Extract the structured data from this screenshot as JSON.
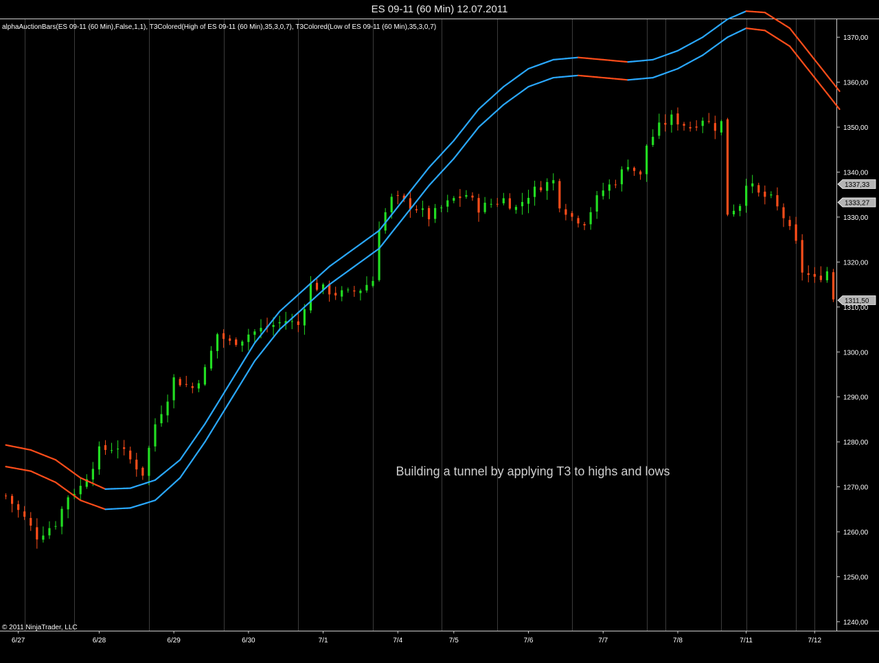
{
  "window": {
    "title": "ES 09-11 (60 Min)  12.07.2011"
  },
  "indicator_label": "alphaAuctionBars(ES 09-11 (60 Min),False,1,1), T3Colored(High of ES 09-11 (60 Min),35,3,0,7), T3Colored(Low of ES 09-11 (60 Min),35,3,0,7)",
  "annotation": "Building a tunnel by applying T3 to highs and lows",
  "copyright": "© 2011 NinjaTrader, LLC",
  "colors": {
    "up": "#22dd22",
    "down": "#ff4d1a",
    "t3_rising": "#2aa8ff",
    "t3_falling": "#ff4d1a",
    "grid": "#666666",
    "background": "#000000"
  },
  "chart_data": {
    "type": "line",
    "ylim": [
      1238,
      1374
    ],
    "y_ticks": [
      "1370,00",
      "1360,00",
      "1350,00",
      "1340,00",
      "1330,00",
      "1320,00",
      "1310,00",
      "1300,00",
      "1290,00",
      "1280,00",
      "1270,00",
      "1260,00",
      "1250,00",
      "1240,00"
    ],
    "y_tick_values": [
      1370,
      1360,
      1350,
      1340,
      1330,
      1320,
      1310,
      1300,
      1290,
      1280,
      1270,
      1260,
      1250,
      1240
    ],
    "x_tick_labels": [
      "6/27",
      "6/28",
      "6/29",
      "6/30",
      "7/1",
      "7/4",
      "7/5",
      "7/6",
      "7/7",
      "7/8",
      "7/11",
      "7/12"
    ],
    "x_tick_bar_index": [
      2,
      15,
      27,
      39,
      51,
      63,
      72,
      84,
      96,
      108,
      119,
      130
    ],
    "session_lines_bar_index": [
      3,
      11,
      23,
      35,
      47,
      59,
      70,
      79,
      91,
      103,
      106,
      115,
      119,
      127,
      130
    ],
    "bar_count": 134,
    "price_markers": [
      {
        "label": "1337,33",
        "value": 1337.33
      },
      {
        "label": "1333,27",
        "value": 1333.27
      },
      {
        "label": "1311,50",
        "value": 1311.5
      }
    ],
    "close_anchors": [
      [
        0,
        1268
      ],
      [
        3,
        1263
      ],
      [
        5,
        1259
      ],
      [
        8,
        1262
      ],
      [
        10,
        1268
      ],
      [
        12,
        1270
      ],
      [
        14,
        1275
      ],
      [
        15,
        1278
      ],
      [
        18,
        1279
      ],
      [
        20,
        1276
      ],
      [
        22,
        1273
      ],
      [
        24,
        1284
      ],
      [
        26,
        1290
      ],
      [
        27,
        1294
      ],
      [
        30,
        1292
      ],
      [
        32,
        1296
      ],
      [
        34,
        1304
      ],
      [
        36,
        1302
      ],
      [
        38,
        1303
      ],
      [
        39,
        1304
      ],
      [
        41,
        1305
      ],
      [
        43,
        1306
      ],
      [
        45,
        1307
      ],
      [
        47,
        1306
      ],
      [
        49,
        1315
      ],
      [
        51,
        1314
      ],
      [
        53,
        1313
      ],
      [
        55,
        1313
      ],
      [
        57,
        1314
      ],
      [
        59,
        1316
      ],
      [
        60,
        1328
      ],
      [
        62,
        1334
      ],
      [
        63,
        1334
      ],
      [
        66,
        1332
      ],
      [
        68,
        1330
      ],
      [
        70,
        1332
      ],
      [
        72,
        1334
      ],
      [
        74,
        1335
      ],
      [
        76,
        1332
      ],
      [
        78,
        1333
      ],
      [
        80,
        1334
      ],
      [
        82,
        1332
      ],
      [
        84,
        1335
      ],
      [
        86,
        1337
      ],
      [
        88,
        1338
      ],
      [
        89,
        1333
      ],
      [
        91,
        1330
      ],
      [
        93,
        1329
      ],
      [
        95,
        1334
      ],
      [
        96,
        1336
      ],
      [
        98,
        1338
      ],
      [
        100,
        1342
      ],
      [
        102,
        1339
      ],
      [
        103,
        1346
      ],
      [
        105,
        1350
      ],
      [
        107,
        1352
      ],
      [
        110,
        1350
      ],
      [
        112,
        1352
      ],
      [
        114,
        1350
      ],
      [
        115,
        1351
      ],
      [
        116,
        1331
      ],
      [
        118,
        1333
      ],
      [
        119,
        1338
      ],
      [
        121,
        1335
      ],
      [
        123,
        1334
      ],
      [
        125,
        1330
      ],
      [
        127,
        1324
      ],
      [
        128,
        1318
      ],
      [
        130,
        1316
      ],
      [
        132,
        1318
      ],
      [
        133,
        1312
      ]
    ],
    "series": [
      {
        "values": [
          [
            0,
            1279.3
          ],
          [
            4,
            1278.2
          ],
          [
            8,
            1276
          ],
          [
            12,
            1272
          ],
          [
            16,
            1269.5
          ],
          [
            20,
            1269.7
          ],
          [
            24,
            1271.5
          ],
          [
            28,
            1276
          ],
          [
            32,
            1284
          ],
          [
            36,
            1293
          ],
          [
            40,
            1302
          ],
          [
            44,
            1309
          ],
          [
            48,
            1314
          ],
          [
            52,
            1319
          ],
          [
            56,
            1323
          ],
          [
            60,
            1327
          ],
          [
            64,
            1334
          ],
          [
            68,
            1341
          ],
          [
            72,
            1347
          ],
          [
            76,
            1354
          ],
          [
            80,
            1359
          ],
          [
            84,
            1363
          ],
          [
            88,
            1365
          ],
          [
            92,
            1365.5
          ],
          [
            96,
            1365
          ],
          [
            100,
            1364.5
          ],
          [
            104,
            1365
          ],
          [
            108,
            1367
          ],
          [
            112,
            1370
          ],
          [
            116,
            1374
          ],
          [
            119,
            1375.8
          ],
          [
            122,
            1375.5
          ],
          [
            126,
            1372
          ],
          [
            130,
            1365
          ],
          [
            134,
            1358
          ]
        ]
      },
      {
        "values": [
          [
            0,
            1274.5
          ],
          [
            4,
            1273.5
          ],
          [
            8,
            1271
          ],
          [
            12,
            1267
          ],
          [
            16,
            1265
          ],
          [
            20,
            1265.3
          ],
          [
            24,
            1267
          ],
          [
            28,
            1272
          ],
          [
            32,
            1280
          ],
          [
            36,
            1289
          ],
          [
            40,
            1298
          ],
          [
            44,
            1305
          ],
          [
            48,
            1310
          ],
          [
            52,
            1315
          ],
          [
            56,
            1319
          ],
          [
            60,
            1323
          ],
          [
            64,
            1330
          ],
          [
            68,
            1337
          ],
          [
            72,
            1343
          ],
          [
            76,
            1350
          ],
          [
            80,
            1355
          ],
          [
            84,
            1359
          ],
          [
            88,
            1361
          ],
          [
            92,
            1361.5
          ],
          [
            96,
            1361
          ],
          [
            100,
            1360.5
          ],
          [
            104,
            1361
          ],
          [
            108,
            1363
          ],
          [
            112,
            1366
          ],
          [
            116,
            1370
          ],
          [
            119,
            1372
          ],
          [
            122,
            1371.5
          ],
          [
            126,
            1368
          ],
          [
            130,
            1361
          ],
          [
            134,
            1354
          ]
        ]
      }
    ]
  }
}
